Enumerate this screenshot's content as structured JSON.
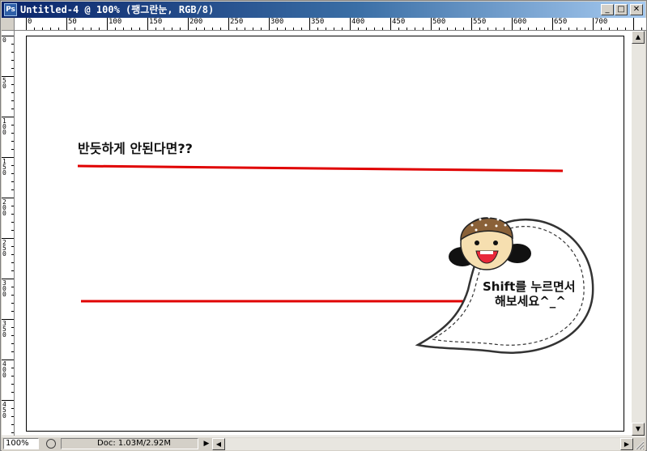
{
  "window": {
    "title": "Untitled-4 @ 100% (팽그란눈, RGB/8)",
    "app_icon_text": "Ps"
  },
  "title_buttons": {
    "minimize": "_",
    "maximize": "□",
    "close": "✕"
  },
  "ruler": {
    "horizontal_labels": [
      "0",
      "50",
      "100",
      "150",
      "200",
      "250",
      "300",
      "350",
      "400",
      "450",
      "500",
      "550",
      "600",
      "650",
      "700"
    ],
    "vertical_labels": [
      "0",
      "50",
      "100",
      "150",
      "200",
      "250",
      "300",
      "350",
      "400",
      "450"
    ]
  },
  "canvas": {
    "heading": "반듯하게 안된다면??",
    "bubble_line_1": "Shift를 누르면서",
    "bubble_line_2": "해보세요^_^",
    "line_color": "#e00000"
  },
  "status": {
    "zoom": "100%",
    "doc_info": "Doc: 1.03M/2.92M",
    "arrow": "▶"
  },
  "scroll": {
    "up": "▲",
    "down": "▼",
    "left": "◀",
    "right": "▶"
  }
}
